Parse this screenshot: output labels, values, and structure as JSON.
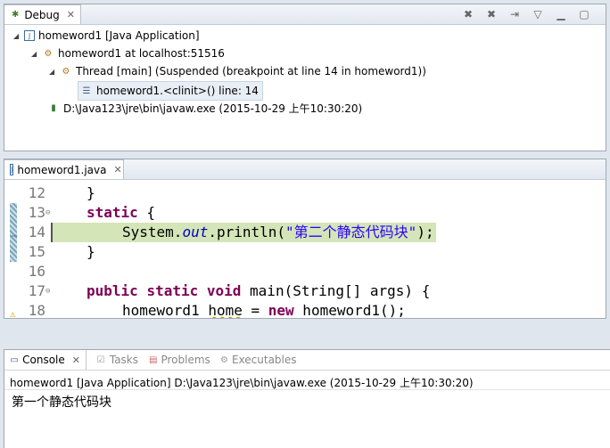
{
  "debug_view": {
    "tab_label": "Debug",
    "tree": [
      {
        "label": "homeword1 [Java Application]",
        "icon": "java-app-icon",
        "expanded": true
      },
      {
        "label": "homeword1 at localhost:51516",
        "icon": "debug-target-icon",
        "expanded": true
      },
      {
        "label": "Thread [main] (Suspended (breakpoint at line 14 in homeword1))",
        "icon": "thread-suspended-icon",
        "expanded": true
      },
      {
        "label": "homeword1.<clinit>() line: 14",
        "icon": "stack-frame-icon"
      },
      {
        "label": "D:\\Java123\\jre\\bin\\javaw.exe (2015-10-29 上午10:30:20)",
        "icon": "process-icon"
      }
    ]
  },
  "editor": {
    "tab_label": "homeword1.java",
    "lines": [
      {
        "num": "12"
      },
      {
        "num": "13"
      },
      {
        "num": "14"
      },
      {
        "num": "15"
      },
      {
        "num": "16"
      },
      {
        "num": "17"
      },
      {
        "num": "18"
      }
    ],
    "code": {
      "l12": "}",
      "l13_kw": "static",
      "l13_rest": " {",
      "l14_a": "System.",
      "l14_field": "out",
      "l14_b": ".println(",
      "l14_str": "\"第二个静态代码块\"",
      "l14_c": ");",
      "l15": "}",
      "l17_kw1": "public",
      "l17_kw2": "static",
      "l17_kw3": "void",
      "l17_rest": " main(String[] args) {",
      "l18_a": "homeword1 ",
      "l18_var": "home",
      "l18_b": " = ",
      "l18_kw": "new",
      "l18_c": " homeword1();"
    }
  },
  "bottom_tabs": [
    {
      "label": "Console",
      "active": true
    },
    {
      "label": "Tasks",
      "active": false
    },
    {
      "label": "Problems",
      "active": false
    },
    {
      "label": "Executables",
      "active": false
    }
  ],
  "console": {
    "header": "homeword1 [Java Application] D:\\Java123\\jre\\bin\\javaw.exe (2015-10-29 上午10:30:20)",
    "output": "第一个静态代码块"
  },
  "colors": {
    "highlight_line": "#d4e5b8",
    "keyword": "#7f0055",
    "string": "#2a00ff",
    "field": "#0000c0"
  }
}
